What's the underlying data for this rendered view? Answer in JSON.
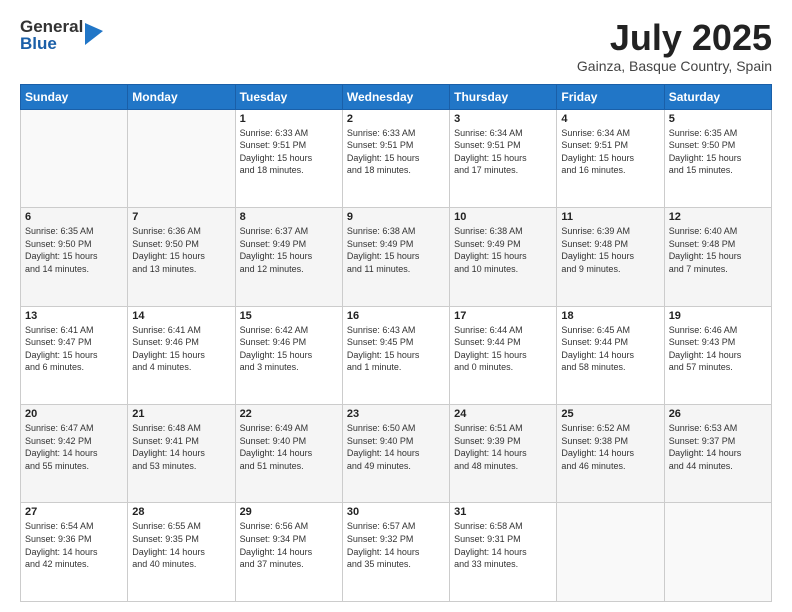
{
  "header": {
    "logo_general": "General",
    "logo_blue": "Blue",
    "month_title": "July 2025",
    "location": "Gainza, Basque Country, Spain"
  },
  "weekdays": [
    "Sunday",
    "Monday",
    "Tuesday",
    "Wednesday",
    "Thursday",
    "Friday",
    "Saturday"
  ],
  "weeks": [
    [
      {
        "num": "",
        "detail": ""
      },
      {
        "num": "",
        "detail": ""
      },
      {
        "num": "1",
        "detail": "Sunrise: 6:33 AM\nSunset: 9:51 PM\nDaylight: 15 hours\nand 18 minutes."
      },
      {
        "num": "2",
        "detail": "Sunrise: 6:33 AM\nSunset: 9:51 PM\nDaylight: 15 hours\nand 18 minutes."
      },
      {
        "num": "3",
        "detail": "Sunrise: 6:34 AM\nSunset: 9:51 PM\nDaylight: 15 hours\nand 17 minutes."
      },
      {
        "num": "4",
        "detail": "Sunrise: 6:34 AM\nSunset: 9:51 PM\nDaylight: 15 hours\nand 16 minutes."
      },
      {
        "num": "5",
        "detail": "Sunrise: 6:35 AM\nSunset: 9:50 PM\nDaylight: 15 hours\nand 15 minutes."
      }
    ],
    [
      {
        "num": "6",
        "detail": "Sunrise: 6:35 AM\nSunset: 9:50 PM\nDaylight: 15 hours\nand 14 minutes."
      },
      {
        "num": "7",
        "detail": "Sunrise: 6:36 AM\nSunset: 9:50 PM\nDaylight: 15 hours\nand 13 minutes."
      },
      {
        "num": "8",
        "detail": "Sunrise: 6:37 AM\nSunset: 9:49 PM\nDaylight: 15 hours\nand 12 minutes."
      },
      {
        "num": "9",
        "detail": "Sunrise: 6:38 AM\nSunset: 9:49 PM\nDaylight: 15 hours\nand 11 minutes."
      },
      {
        "num": "10",
        "detail": "Sunrise: 6:38 AM\nSunset: 9:49 PM\nDaylight: 15 hours\nand 10 minutes."
      },
      {
        "num": "11",
        "detail": "Sunrise: 6:39 AM\nSunset: 9:48 PM\nDaylight: 15 hours\nand 9 minutes."
      },
      {
        "num": "12",
        "detail": "Sunrise: 6:40 AM\nSunset: 9:48 PM\nDaylight: 15 hours\nand 7 minutes."
      }
    ],
    [
      {
        "num": "13",
        "detail": "Sunrise: 6:41 AM\nSunset: 9:47 PM\nDaylight: 15 hours\nand 6 minutes."
      },
      {
        "num": "14",
        "detail": "Sunrise: 6:41 AM\nSunset: 9:46 PM\nDaylight: 15 hours\nand 4 minutes."
      },
      {
        "num": "15",
        "detail": "Sunrise: 6:42 AM\nSunset: 9:46 PM\nDaylight: 15 hours\nand 3 minutes."
      },
      {
        "num": "16",
        "detail": "Sunrise: 6:43 AM\nSunset: 9:45 PM\nDaylight: 15 hours\nand 1 minute."
      },
      {
        "num": "17",
        "detail": "Sunrise: 6:44 AM\nSunset: 9:44 PM\nDaylight: 15 hours\nand 0 minutes."
      },
      {
        "num": "18",
        "detail": "Sunrise: 6:45 AM\nSunset: 9:44 PM\nDaylight: 14 hours\nand 58 minutes."
      },
      {
        "num": "19",
        "detail": "Sunrise: 6:46 AM\nSunset: 9:43 PM\nDaylight: 14 hours\nand 57 minutes."
      }
    ],
    [
      {
        "num": "20",
        "detail": "Sunrise: 6:47 AM\nSunset: 9:42 PM\nDaylight: 14 hours\nand 55 minutes."
      },
      {
        "num": "21",
        "detail": "Sunrise: 6:48 AM\nSunset: 9:41 PM\nDaylight: 14 hours\nand 53 minutes."
      },
      {
        "num": "22",
        "detail": "Sunrise: 6:49 AM\nSunset: 9:40 PM\nDaylight: 14 hours\nand 51 minutes."
      },
      {
        "num": "23",
        "detail": "Sunrise: 6:50 AM\nSunset: 9:40 PM\nDaylight: 14 hours\nand 49 minutes."
      },
      {
        "num": "24",
        "detail": "Sunrise: 6:51 AM\nSunset: 9:39 PM\nDaylight: 14 hours\nand 48 minutes."
      },
      {
        "num": "25",
        "detail": "Sunrise: 6:52 AM\nSunset: 9:38 PM\nDaylight: 14 hours\nand 46 minutes."
      },
      {
        "num": "26",
        "detail": "Sunrise: 6:53 AM\nSunset: 9:37 PM\nDaylight: 14 hours\nand 44 minutes."
      }
    ],
    [
      {
        "num": "27",
        "detail": "Sunrise: 6:54 AM\nSunset: 9:36 PM\nDaylight: 14 hours\nand 42 minutes."
      },
      {
        "num": "28",
        "detail": "Sunrise: 6:55 AM\nSunset: 9:35 PM\nDaylight: 14 hours\nand 40 minutes."
      },
      {
        "num": "29",
        "detail": "Sunrise: 6:56 AM\nSunset: 9:34 PM\nDaylight: 14 hours\nand 37 minutes."
      },
      {
        "num": "30",
        "detail": "Sunrise: 6:57 AM\nSunset: 9:32 PM\nDaylight: 14 hours\nand 35 minutes."
      },
      {
        "num": "31",
        "detail": "Sunrise: 6:58 AM\nSunset: 9:31 PM\nDaylight: 14 hours\nand 33 minutes."
      },
      {
        "num": "",
        "detail": ""
      },
      {
        "num": "",
        "detail": ""
      }
    ]
  ]
}
